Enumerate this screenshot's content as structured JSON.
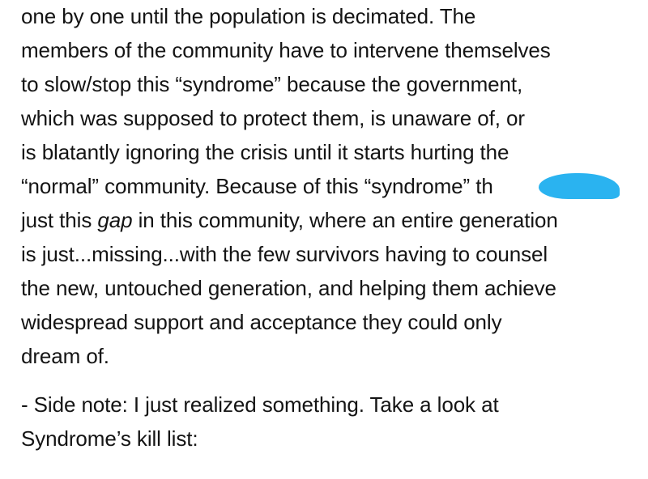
{
  "paragraph_1": {
    "line_1": "one by one until the population is decimated. The",
    "line_2": "members of the community have to intervene themselves",
    "line_3": "to slow/stop this “syndrome” because the government,",
    "line_4": "which was supposed to protect them, is unaware of, or",
    "line_5": "is blatantly ignoring the crisis until it starts hurting the",
    "line_6": "“normal” community. Because of this “syndrome” th",
    "line_7_before": "just this ",
    "line_7_emphasis": "gap",
    "line_7_after": " in this community, where an entire generation",
    "line_8": "is just...missing...with the few survivors having to counsel",
    "line_9": "the new, untouched generation, and helping them achieve",
    "line_10": "widespread support and acceptance they could only",
    "line_11": "dream of."
  },
  "paragraph_2": {
    "line_1": "- Side note: I just realized something. Take a look at",
    "line_2": "Syndrome’s kill list:"
  },
  "colors": {
    "text": "#141414",
    "redaction": "#2ab3f0"
  }
}
